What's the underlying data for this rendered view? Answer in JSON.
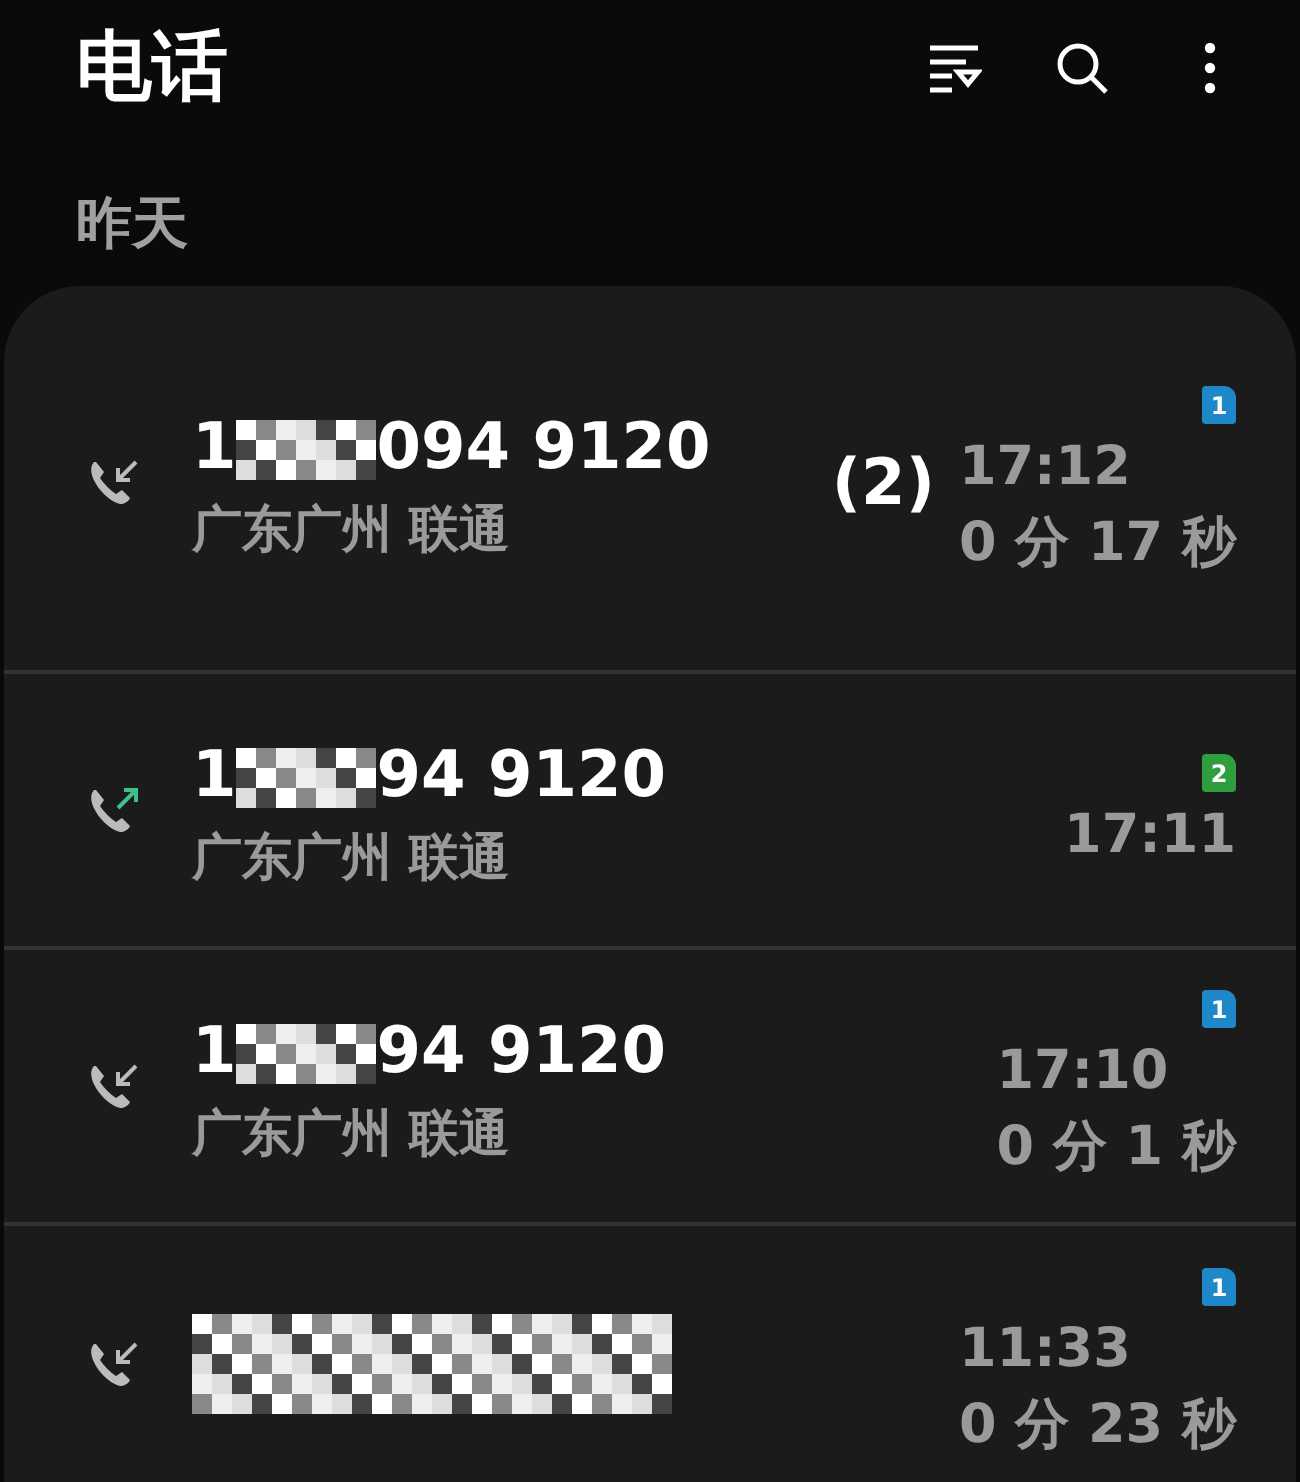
{
  "header": {
    "title": "电话"
  },
  "section": {
    "label": "昨天"
  },
  "calls": [
    {
      "kind": "incoming",
      "number_start": "1",
      "number_end": "094 9120",
      "location": "广东广州 联通",
      "count": "(2)",
      "sim": "1",
      "color": "#1e88c8",
      "time": "17:12",
      "duration": "0 分 17 秒"
    },
    {
      "kind": "outgoing",
      "number_start": "1",
      "number_end": "94 9120",
      "location": "广东广州 联通",
      "sim": "2",
      "color": "#2e9e3e",
      "time": "17:11"
    },
    {
      "kind": "incoming",
      "number_start": "1",
      "number_end": "94 9120",
      "location": "广东广州 联通",
      "sim": "1",
      "color": "#1e88c8",
      "time": "17:10",
      "duration": "0 分 1 秒"
    },
    {
      "kind": "incoming",
      "sim": "1",
      "color": "#1e88c8",
      "time": "11:33",
      "duration": "0 分 23 秒"
    }
  ]
}
